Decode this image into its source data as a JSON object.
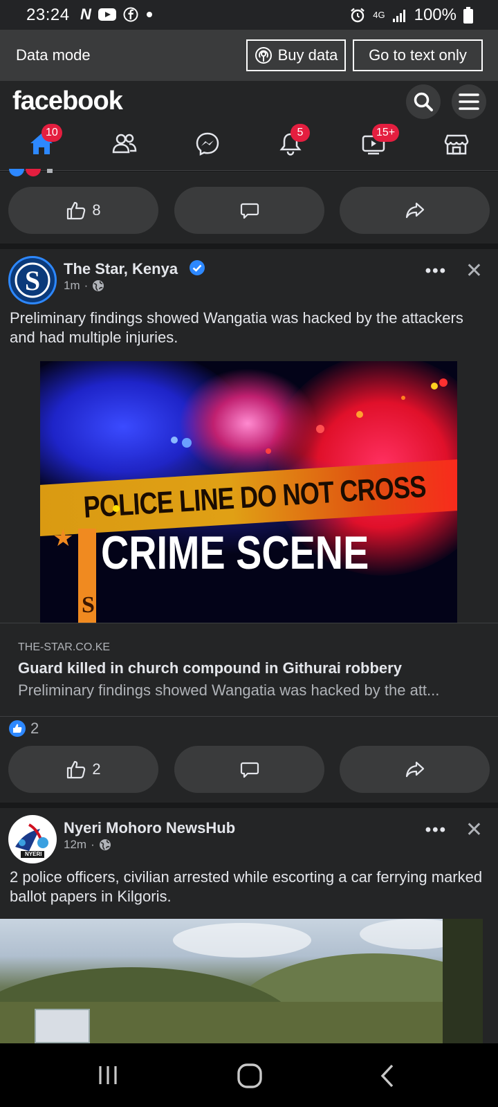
{
  "status_bar": {
    "time": "23:24",
    "network": "4G",
    "battery": "100%",
    "left_icons": [
      "netflix-icon",
      "youtube-icon",
      "facebook-icon",
      "dot-icon"
    ]
  },
  "data_mode": {
    "label": "Data mode",
    "buy_data": "Buy data",
    "text_only": "Go to text only"
  },
  "header": {
    "logo": "facebook",
    "nav": [
      {
        "name": "home",
        "badge": "10"
      },
      {
        "name": "friends",
        "badge": ""
      },
      {
        "name": "messenger",
        "badge": ""
      },
      {
        "name": "notifications",
        "badge": "5"
      },
      {
        "name": "watch",
        "badge": "15+"
      },
      {
        "name": "marketplace",
        "badge": ""
      }
    ]
  },
  "prev_post": {
    "like_count": "8"
  },
  "post1": {
    "author": "The Star, Kenya",
    "time": "1m",
    "text": "Preliminary findings showed Wangatia was hacked by the attackers and had multiple injuries.",
    "image_tape_text": "POLICE LINE DO NOT CROSS",
    "image_caption": "CRIME SCENE",
    "image_logo": "S",
    "link_domain": "THE-STAR.CO.KE",
    "link_title": "Guard killed in church compound in Githurai robbery",
    "link_desc": "Preliminary findings showed Wangatia was hacked by the att...",
    "reaction_count": "2",
    "like_count": "2"
  },
  "post2": {
    "author": "Nyeri Mohoro NewsHub",
    "time": "12m",
    "text": "2 police officers, civilian arrested while escorting a car ferrying marked ballot papers in Kilgoris.",
    "avatar_text": "NYERI"
  },
  "colors": {
    "background": "#18191a",
    "card": "#242526",
    "button": "#3a3b3c",
    "accent": "#2d88ff",
    "badge": "#e41e3f"
  }
}
